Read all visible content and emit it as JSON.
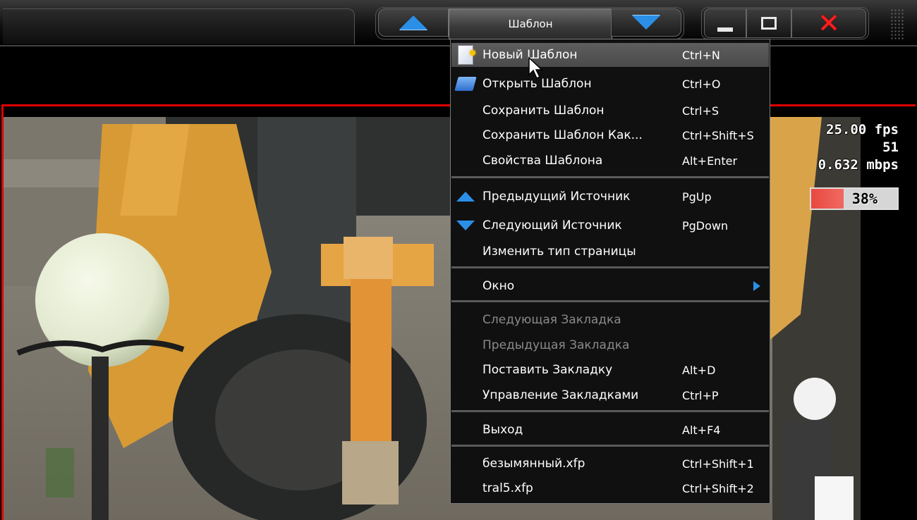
{
  "titlebar": {
    "menu_title": "Шаблон"
  },
  "stats": {
    "fps": "25.00 fps",
    "frame": "51",
    "bitrate": "0.632 mbps",
    "load_percent_label": "38%",
    "load_fraction": 0.38,
    "accent": "#e00000",
    "bar_color": "#e8483f"
  },
  "menu": {
    "items": [
      {
        "label": "Новый Шаблон",
        "shortcut": "Ctrl+N",
        "icon": "new-document-icon",
        "highlighted": true
      },
      {
        "label": "Открыть Шаблон",
        "shortcut": "Ctrl+O",
        "icon": "open-folder-icon"
      },
      {
        "label": "Сохранить Шаблон",
        "shortcut": "Ctrl+S"
      },
      {
        "label": "Сохранить Шаблон Как...",
        "shortcut": "Ctrl+Shift+S"
      },
      {
        "label": "Свойства Шаблона",
        "shortcut": "Alt+Enter"
      },
      {
        "label": "Предыдущий Источник",
        "shortcut": "PgUp",
        "icon": "arrow-up-icon"
      },
      {
        "label": "Следующий Источник",
        "shortcut": "PgDown",
        "icon": "arrow-down-icon"
      },
      {
        "label": "Изменить тип страницы",
        "shortcut": ""
      },
      {
        "label": "Окно",
        "shortcut": "",
        "submenu": true
      },
      {
        "label": "Следующая Закладка",
        "shortcut": "",
        "disabled": true
      },
      {
        "label": "Предыдущая Закладка",
        "shortcut": "",
        "disabled": true
      },
      {
        "label": "Поставить Закладку",
        "shortcut": "Alt+D"
      },
      {
        "label": "Управление Закладками",
        "shortcut": "Ctrl+P"
      },
      {
        "label": "Выход",
        "shortcut": "Alt+F4"
      },
      {
        "label": "безымянный.xfp",
        "shortcut": "Ctrl+Shift+1"
      },
      {
        "label": "tral5.xfp",
        "shortcut": "Ctrl+Shift+2"
      }
    ]
  }
}
